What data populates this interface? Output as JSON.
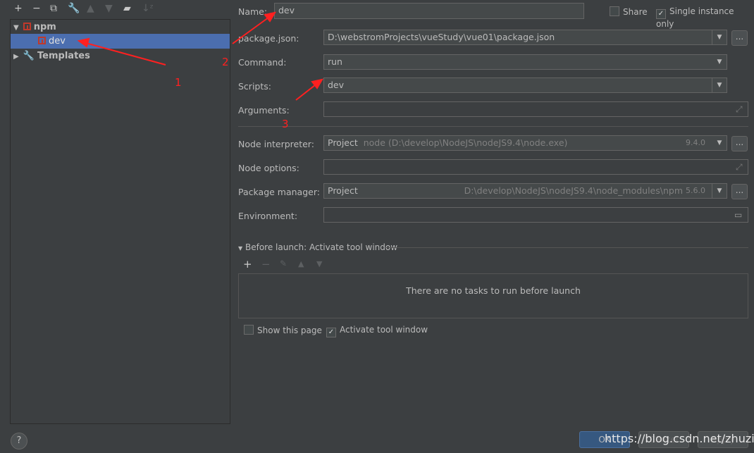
{
  "toolbar": {
    "icons": [
      "plus-icon",
      "minus-icon",
      "copy-icon",
      "wrench-icon",
      "arrow-up-icon",
      "arrow-down-icon",
      "new-folder-icon",
      "sort-icon"
    ]
  },
  "tree": {
    "npm": "npm",
    "dev": "dev",
    "templates": "Templates"
  },
  "form": {
    "name_label": "Name:",
    "name_value": "dev",
    "share_label": "Share",
    "share_checked": false,
    "single_label": "Single instance only",
    "single_checked": true,
    "package_label": "package.json:",
    "package_value": "D:\\webstromProjects\\vueStudy\\vue01\\package.json",
    "command_label": "Command:",
    "command_value": "run",
    "scripts_label": "Scripts:",
    "scripts_value": "dev",
    "arguments_label": "Arguments:",
    "arguments_value": "",
    "interpreter_label": "Node interpreter:",
    "interpreter_value": "Project",
    "interpreter_path": "node (D:\\develop\\NodeJS\\nodeJS9.4\\node.exe)",
    "interpreter_version": "9.4.0",
    "options_label": "Node options:",
    "options_value": "",
    "pm_label": "Package manager:",
    "pm_value": "Project",
    "pm_path": "D:\\develop\\NodeJS\\nodeJS9.4\\node_modules\\npm",
    "pm_version": "5.6.0",
    "env_label": "Environment:",
    "env_value": "",
    "browse": "..."
  },
  "before_launch": {
    "title": "Before launch: Activate tool window",
    "empty_text": "There are no tasks to run before launch",
    "show_page": "Show this page",
    "show_page_checked": false,
    "activate": "Activate tool window",
    "activate_checked": true
  },
  "annotations": {
    "a1": "1",
    "a2": "2",
    "a3": "3"
  },
  "dialog": {
    "help": "?",
    "ok": "OK",
    "cancel": "Cancel",
    "apply": "Apply"
  },
  "watermark": "https://blog.csdn.net/zhuzicc",
  "colors": {
    "selection": "#4b6eaf",
    "ok_button": "#365880",
    "annotation": "#ff2020"
  }
}
